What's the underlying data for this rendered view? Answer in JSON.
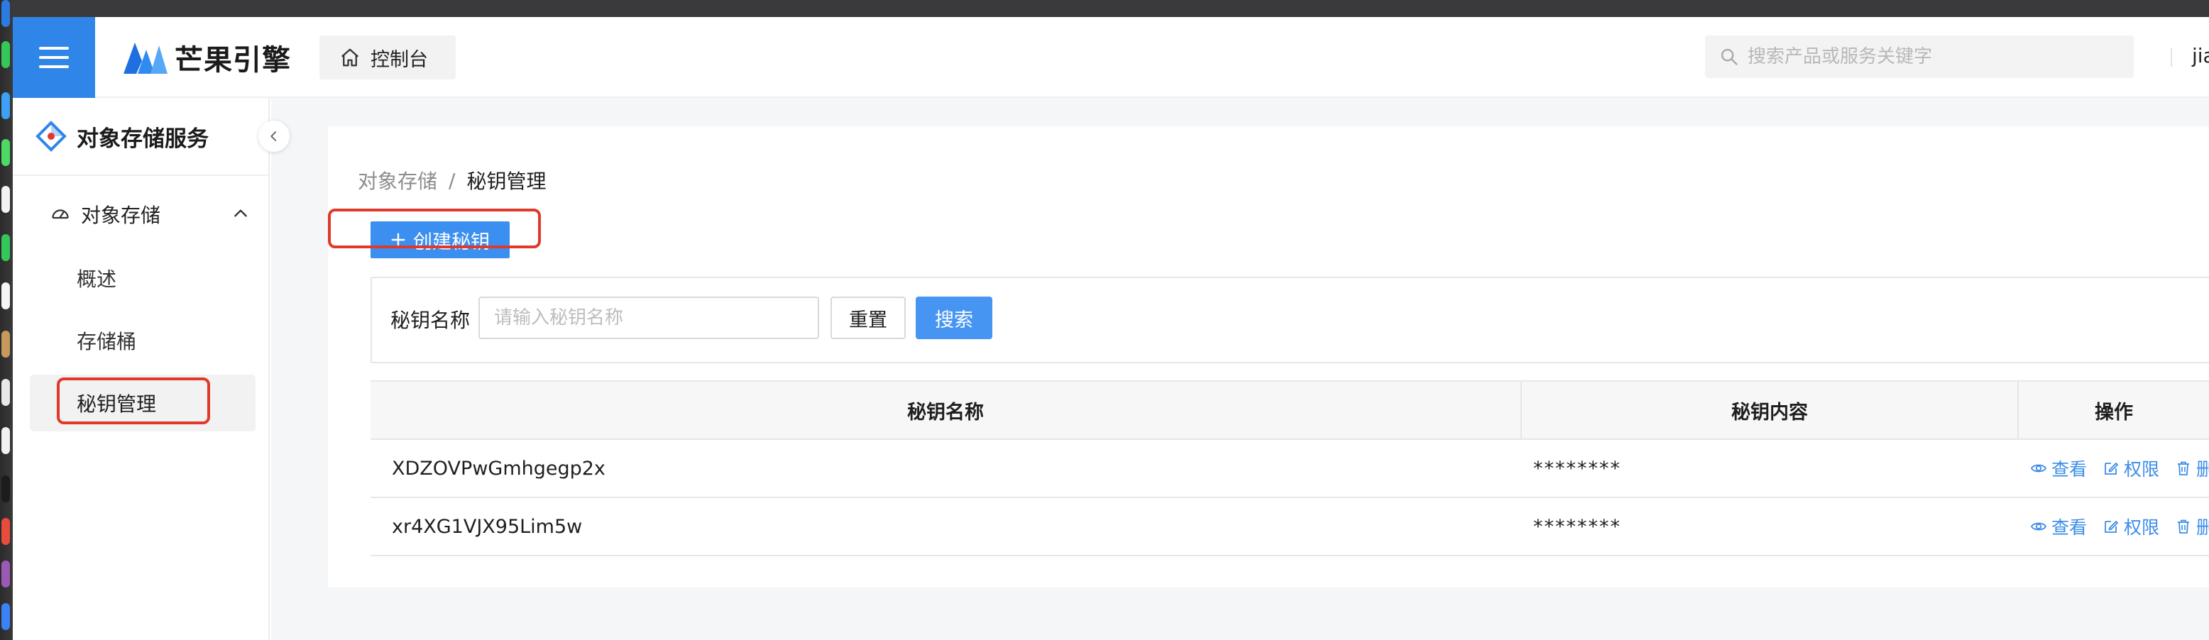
{
  "app": {
    "logo_text": "芒果引擎",
    "console_tab": "控制台",
    "search_placeholder": "搜索产品或服务关键字",
    "user_name": "jia"
  },
  "sidebar": {
    "service_title": "对象存储服务",
    "group": {
      "label": "对象存储",
      "icon": "dashboard-icon"
    },
    "items": [
      {
        "label": "概述"
      },
      {
        "label": "存储桶"
      },
      {
        "label": "秘钥管理",
        "active": true
      }
    ]
  },
  "breadcrumb": {
    "parent": "对象存储",
    "separator": "/",
    "current": "秘钥管理"
  },
  "toolbar": {
    "create_label": "创建秘钥"
  },
  "filter": {
    "label": "秘钥名称",
    "input_placeholder": "请输入秘钥名称",
    "input_value": "",
    "reset_label": "重置",
    "search_label": "搜索"
  },
  "table": {
    "columns": [
      "秘钥名称",
      "秘钥内容",
      "操作"
    ],
    "rows": [
      {
        "name": "XDZOVPwGmhgegp2x",
        "content": "********"
      },
      {
        "name": "xr4XG1VJX95Lim5w",
        "content": "********"
      }
    ],
    "actions": {
      "view": "查看",
      "permission": "权限",
      "delete": "删"
    }
  },
  "colors": {
    "primary": "#3b8ff0",
    "highlight_outline": "#e0392b",
    "link": "#3a8ce8"
  }
}
